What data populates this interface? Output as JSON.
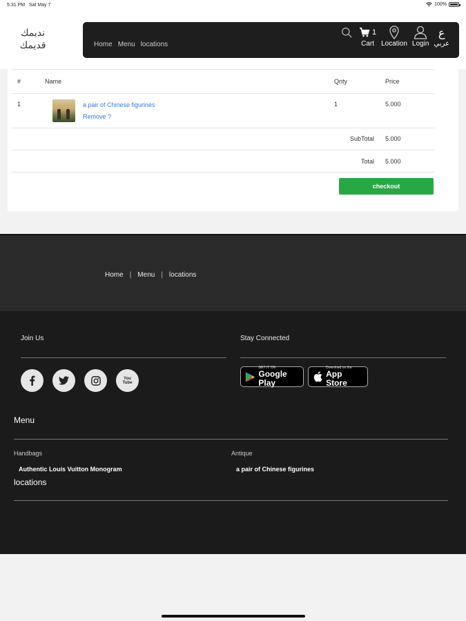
{
  "status_bar": {
    "time": "5:31 PM",
    "date": "Sat May 7",
    "battery": "100%"
  },
  "header": {
    "logo_line1": "نديمك",
    "logo_line2": "قديمك",
    "nav_links": [
      "Home",
      "Menu",
      "locations"
    ],
    "cart_count": "1",
    "cart_label": "Cart",
    "location_label": "Location",
    "login_label": "Login",
    "lang_glyph": "ع",
    "lang_label": "عربي"
  },
  "cart": {
    "columns": {
      "index": "#",
      "name": "Name",
      "qty": "Qnty",
      "price": "Price"
    },
    "items": [
      {
        "index": "1",
        "name": "a pair of Chinese figurines",
        "remove": "Remove ?",
        "qty": "1",
        "price": "5.000"
      }
    ],
    "subtotal_label": "SubTotal",
    "subtotal_value": "5.000",
    "total_label": "Total",
    "total_value": "5.000",
    "checkout_label": "checkout"
  },
  "footer_nav": {
    "links": [
      "Home",
      "Menu",
      "locations"
    ],
    "separator": "|"
  },
  "footer": {
    "join_us": "Join Us",
    "stay_connected": "Stay Connected",
    "social": [
      "facebook",
      "twitter",
      "instagram",
      "youtube"
    ],
    "youtube_text": "You Tube",
    "google_play_small": "GET IT ON",
    "google_play_big": "Google Play",
    "app_store_small": "Download on the",
    "app_store_big": "App Store",
    "menu_heading": "Menu",
    "categories": [
      {
        "name": "Handbags",
        "product": "Authentic Louis Vuitton Monogram"
      },
      {
        "name": "Antique",
        "product": "a pair of Chinese figurines"
      }
    ],
    "locations_heading": "locations"
  },
  "colors": {
    "navbar": "#1e1e1e",
    "checkout": "#28a745",
    "link": "#2f7de1",
    "footer": "#1b1b1b"
  }
}
